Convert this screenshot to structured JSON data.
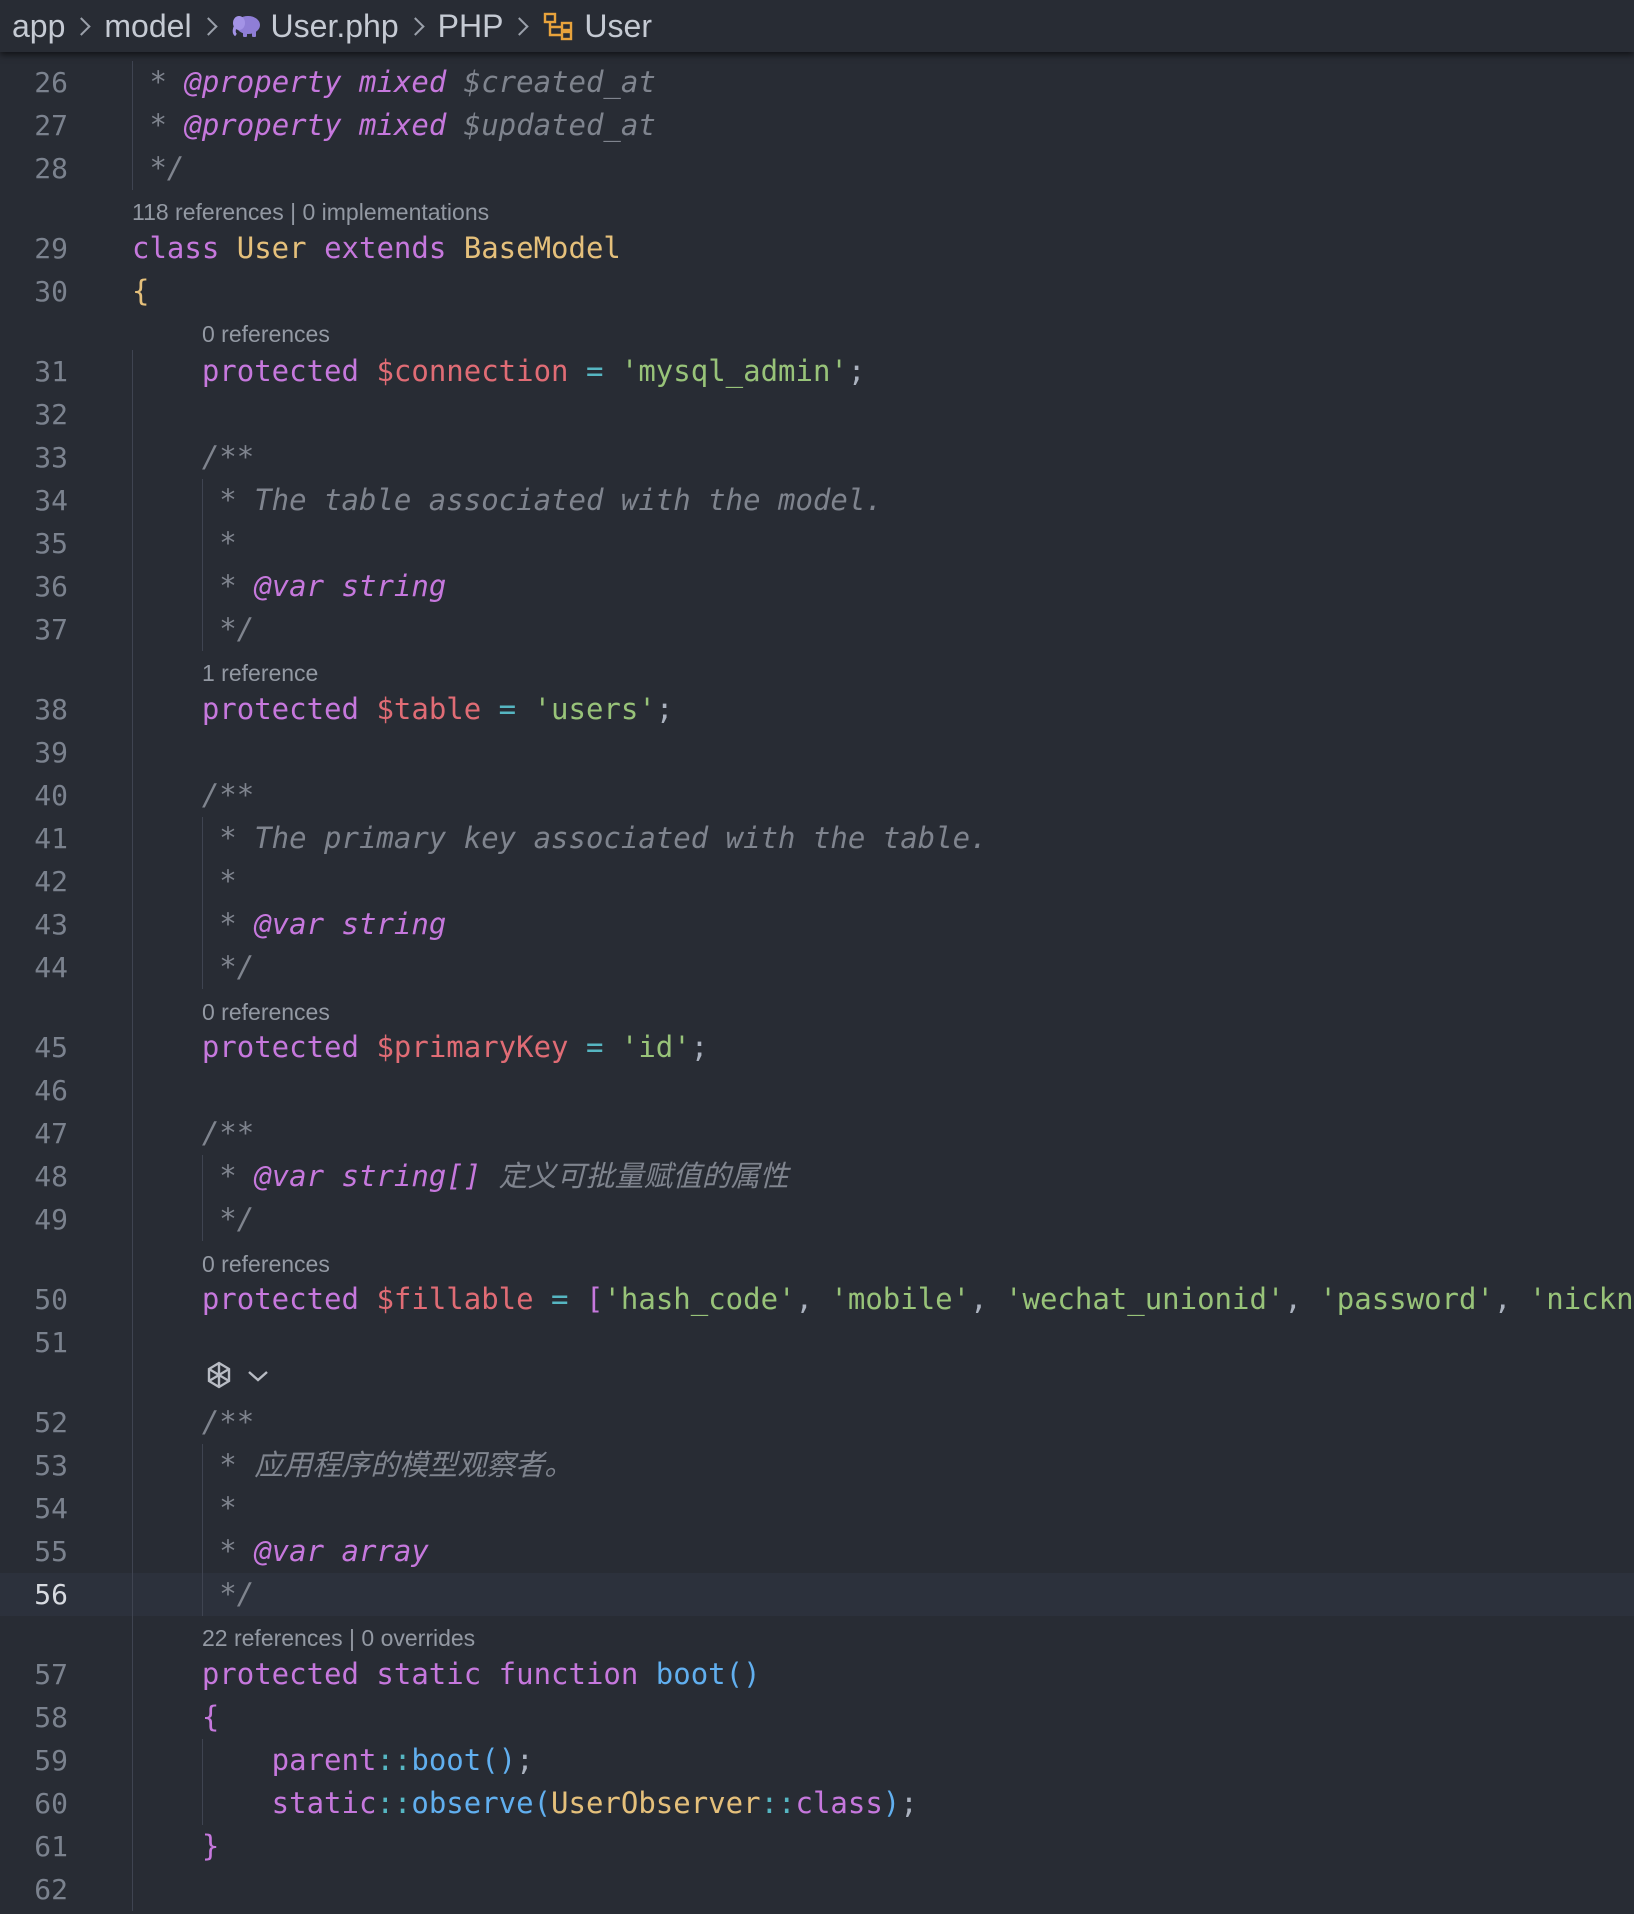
{
  "breadcrumb": {
    "items": [
      "app",
      "model",
      "User.php",
      "PHP",
      "User"
    ]
  },
  "editor": {
    "current_line": 56,
    "code_lens": {
      "class": "118 references | 0 implementations",
      "connection": "0 references",
      "table": "1 reference",
      "primary_key": "0 references",
      "fillable": "0 references",
      "boot": "22 references | 0 overrides"
    },
    "lines": [
      {
        "n": 26,
        "tokens": [
          [
            "cm",
            " * "
          ],
          [
            "tag",
            "@property"
          ],
          [
            "tag",
            " mixed"
          ],
          [
            "cm",
            " $created_at"
          ]
        ]
      },
      {
        "n": 27,
        "tokens": [
          [
            "cm",
            " * "
          ],
          [
            "tag",
            "@property"
          ],
          [
            "tag",
            " mixed"
          ],
          [
            "cm",
            " $updated_at"
          ]
        ]
      },
      {
        "n": 28,
        "tokens": [
          [
            "cm",
            " */"
          ]
        ]
      },
      {
        "n": 29,
        "tokens": [
          [
            "kw",
            "class "
          ],
          [
            "cls",
            "User"
          ],
          [
            "kw",
            " extends "
          ],
          [
            "cls",
            "BaseModel"
          ]
        ]
      },
      {
        "n": 30,
        "tokens": [
          [
            "br1",
            "{"
          ]
        ]
      },
      {
        "n": 31,
        "tokens": [
          [
            "kw",
            "    protected "
          ],
          [
            "var",
            "$connection"
          ],
          [
            "op",
            " = "
          ],
          [
            "str",
            "'mysql_admin'"
          ],
          [
            "pun",
            ";"
          ]
        ]
      },
      {
        "n": 32,
        "tokens": []
      },
      {
        "n": 33,
        "tokens": [
          [
            "cm",
            "    /**"
          ]
        ]
      },
      {
        "n": 34,
        "tokens": [
          [
            "cm",
            "     * The table associated with the model."
          ]
        ]
      },
      {
        "n": 35,
        "tokens": [
          [
            "cm",
            "     *"
          ]
        ]
      },
      {
        "n": 36,
        "tokens": [
          [
            "cm",
            "     * "
          ],
          [
            "tag",
            "@var"
          ],
          [
            "tag",
            " string"
          ]
        ]
      },
      {
        "n": 37,
        "tokens": [
          [
            "cm",
            "     */"
          ]
        ]
      },
      {
        "n": 38,
        "tokens": [
          [
            "kw",
            "    protected "
          ],
          [
            "var",
            "$table"
          ],
          [
            "op",
            " = "
          ],
          [
            "str",
            "'users'"
          ],
          [
            "pun",
            ";"
          ]
        ]
      },
      {
        "n": 39,
        "tokens": []
      },
      {
        "n": 40,
        "tokens": [
          [
            "cm",
            "    /**"
          ]
        ]
      },
      {
        "n": 41,
        "tokens": [
          [
            "cm",
            "     * The primary key associated with the table."
          ]
        ]
      },
      {
        "n": 42,
        "tokens": [
          [
            "cm",
            "     *"
          ]
        ]
      },
      {
        "n": 43,
        "tokens": [
          [
            "cm",
            "     * "
          ],
          [
            "tag",
            "@var"
          ],
          [
            "tag",
            " string"
          ]
        ]
      },
      {
        "n": 44,
        "tokens": [
          [
            "cm",
            "     */"
          ]
        ]
      },
      {
        "n": 45,
        "tokens": [
          [
            "kw",
            "    protected "
          ],
          [
            "var",
            "$primaryKey"
          ],
          [
            "op",
            " = "
          ],
          [
            "str",
            "'id'"
          ],
          [
            "pun",
            ";"
          ]
        ]
      },
      {
        "n": 46,
        "tokens": []
      },
      {
        "n": 47,
        "tokens": [
          [
            "cm",
            "    /**"
          ]
        ]
      },
      {
        "n": 48,
        "tokens": [
          [
            "cm",
            "     * "
          ],
          [
            "tag",
            "@var"
          ],
          [
            "tag",
            " string[]"
          ],
          [
            "cm",
            " 定义可批量赋值的属性"
          ]
        ]
      },
      {
        "n": 49,
        "tokens": [
          [
            "cm",
            "     */"
          ]
        ]
      },
      {
        "n": 50,
        "tokens": [
          [
            "kw",
            "    protected "
          ],
          [
            "var",
            "$fillable"
          ],
          [
            "op",
            " = "
          ],
          [
            "br2",
            "["
          ],
          [
            "str",
            "'hash_code'"
          ],
          [
            "pun",
            ", "
          ],
          [
            "str",
            "'mobile'"
          ],
          [
            "pun",
            ", "
          ],
          [
            "str",
            "'wechat_unionid'"
          ],
          [
            "pun",
            ", "
          ],
          [
            "str",
            "'password'"
          ],
          [
            "pun",
            ", "
          ],
          [
            "str",
            "'nickna"
          ]
        ]
      },
      {
        "n": 51,
        "tokens": []
      },
      {
        "n": 52,
        "tokens": [
          [
            "cm",
            "    /**"
          ]
        ]
      },
      {
        "n": 53,
        "tokens": [
          [
            "cm",
            "     * 应用程序的模型观察者。"
          ]
        ]
      },
      {
        "n": 54,
        "tokens": [
          [
            "cm",
            "     *"
          ]
        ]
      },
      {
        "n": 55,
        "tokens": [
          [
            "cm",
            "     * "
          ],
          [
            "tag",
            "@var"
          ],
          [
            "tag",
            " array"
          ]
        ]
      },
      {
        "n": 56,
        "tokens": [
          [
            "cm",
            "     */"
          ]
        ]
      },
      {
        "n": 57,
        "tokens": [
          [
            "kw",
            "    protected static function "
          ],
          [
            "fn",
            "boot"
          ],
          [
            "br3",
            "()"
          ]
        ]
      },
      {
        "n": 58,
        "tokens": [
          [
            "br2",
            "    {"
          ]
        ]
      },
      {
        "n": 59,
        "tokens": [
          [
            "kw",
            "        parent"
          ],
          [
            "op",
            "::"
          ],
          [
            "fn",
            "boot"
          ],
          [
            "br3",
            "()"
          ],
          [
            "pun",
            ";"
          ]
        ]
      },
      {
        "n": 60,
        "tokens": [
          [
            "kw",
            "        static"
          ],
          [
            "op",
            "::"
          ],
          [
            "fn",
            "observe"
          ],
          [
            "br3",
            "("
          ],
          [
            "cls",
            "UserObserver"
          ],
          [
            "op",
            "::"
          ],
          [
            "kw",
            "class"
          ],
          [
            "br3",
            ")"
          ],
          [
            "pun",
            ";"
          ]
        ]
      },
      {
        "n": 61,
        "tokens": [
          [
            "br2",
            "    }"
          ]
        ]
      },
      {
        "n": 62,
        "tokens": []
      }
    ]
  },
  "icons": {
    "breadcrumb_file": "php-elephant-icon",
    "breadcrumb_symbol": "class-symbol-icon",
    "ai_widget": "openai-logo-icon",
    "ai_widget_toggle": "chevron-down-icon"
  },
  "colors": {
    "background": "#282c34",
    "keyword": "#c678dd",
    "variable": "#e06c75",
    "string": "#98c379",
    "class": "#e5c07b",
    "function": "#61afef",
    "comment": "#7f848e"
  }
}
